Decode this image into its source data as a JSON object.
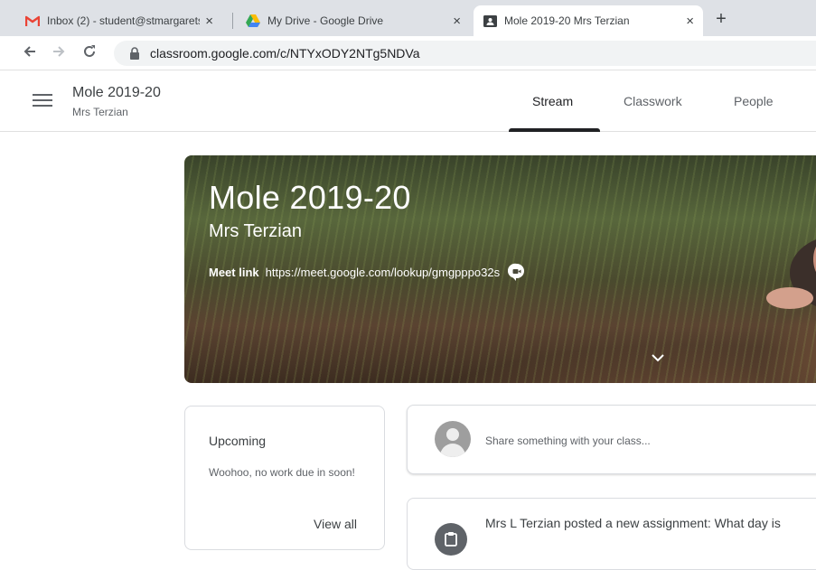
{
  "browser": {
    "tabs": [
      {
        "title": "Inbox (2) - student@stmargarets...",
        "icon": "gmail-icon",
        "active": false
      },
      {
        "title": "My Drive - Google Drive",
        "icon": "google-drive-icon",
        "active": false
      },
      {
        "title": "Mole 2019-20 Mrs Terzian",
        "icon": "classroom-icon",
        "active": true
      }
    ],
    "new_tab_label": "+",
    "close_glyph": "×",
    "url": "classroom.google.com/c/NTYxODY2NTg5NDVa"
  },
  "appbar": {
    "class_name": "Mole 2019-20",
    "teacher": "Mrs Terzian",
    "tabs": [
      {
        "label": "Stream",
        "active": true
      },
      {
        "label": "Classwork",
        "active": false
      },
      {
        "label": "People",
        "active": false
      }
    ]
  },
  "banner": {
    "title": "Mole 2019-20",
    "subtitle": "Mrs Terzian",
    "meet_label": "Meet link",
    "meet_url": "https://meet.google.com/lookup/gmgpppo32s"
  },
  "upcoming": {
    "title": "Upcoming",
    "message": "Woohoo, no work due in soon!",
    "view_all": "View all"
  },
  "share": {
    "placeholder": "Share something with your class..."
  },
  "post": {
    "text": "Mrs L Terzian posted a new assignment: What day is"
  },
  "colors": {
    "gmail_red": "#ea4335",
    "text_primary": "#3c4043",
    "text_secondary": "#5f6368",
    "tab_strip": "#dee1e6"
  }
}
